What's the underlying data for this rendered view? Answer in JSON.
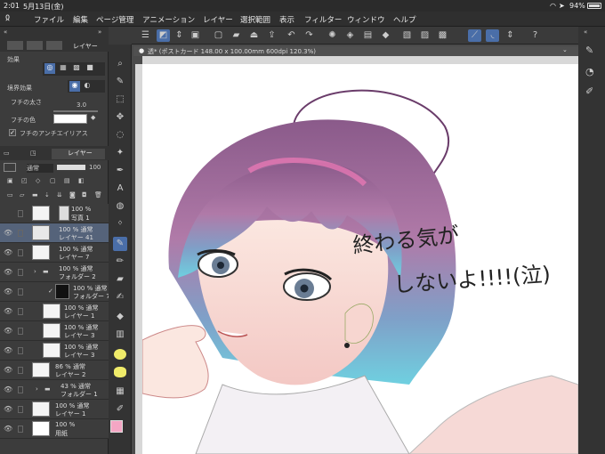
{
  "status": {
    "time": "2:01",
    "date": "5月13日(金)",
    "battery": "94%"
  },
  "menu": [
    "ファイル",
    "編集",
    "ページ管理",
    "アニメーション",
    "レイヤー",
    "選択範囲",
    "表示",
    "フィルター",
    "ウィンドウ",
    "ヘルプ"
  ],
  "document": {
    "tab_title": "透* (ポストカード 148.00 x 100.00mm 600dpi 120.3%)"
  },
  "left_panel": {
    "panel_tab_label": "レイヤー",
    "effect_header": "効果",
    "border_effect_label": "境界効果",
    "edge_width_label": "フチの太さ",
    "edge_width_value": "3.0",
    "edge_color_label": "フチの色",
    "antialias_label": "フチのアンチエイリアス",
    "layer_tab_label": "レイヤー",
    "blend_mode": "通常",
    "opacity": "100"
  },
  "layers": [
    {
      "line1": "100 %",
      "line2": "写真 1"
    },
    {
      "line1": "100 % 通常",
      "line2": "レイヤー 41"
    },
    {
      "line1": "100 % 通常",
      "line2": "レイヤー 7"
    },
    {
      "line1": "100 % 通常",
      "line2": "フォルダー 2"
    },
    {
      "line1": "100 % 通常",
      "line2": "フォルダー 7"
    },
    {
      "line1": "100 % 通常",
      "line2": "レイヤー 1"
    },
    {
      "line1": "100 % 通常",
      "line2": "レイヤー 3"
    },
    {
      "line1": "100 % 通常",
      "line2": "レイヤー 3"
    },
    {
      "line1": "86 % 通常",
      "line2": "レイヤー 2"
    },
    {
      "line1": "43 % 通常",
      "line2": "フォルダー 1"
    },
    {
      "line1": "100 % 通常",
      "line2": "レイヤー 1"
    },
    {
      "line1": "100 %",
      "line2": "用紙"
    }
  ],
  "canvas_text": {
    "line1": "終わる気が",
    "line2": "しないよ!!!!(泣)"
  },
  "colors": {
    "main_color": "#f4a6c4",
    "sub_color": "#000000",
    "accent": "#4a6ea8"
  }
}
